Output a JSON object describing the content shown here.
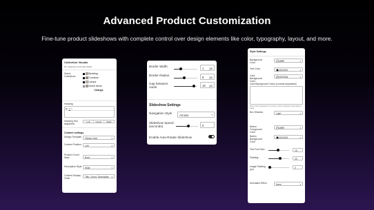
{
  "hero": {
    "title": "Advanced Product Customization",
    "subtitle": "Fine-tune product slideshows with complete control over design elements like color, typography, layout, and more."
  },
  "panel1": {
    "title": "Collection Visuals",
    "subtitle": "ID: Collection & Product Slider",
    "select_label": "Select Collections",
    "collections": [
      {
        "label": "Bedding",
        "checked": true
      },
      {
        "label": "Furniture",
        "checked": true
      },
      {
        "label": "Lamps",
        "checked": true
      },
      {
        "label": "Home items",
        "checked": false
      }
    ],
    "change_button": "Change",
    "heading_label": "Heading",
    "heading_align_label": "Heading Text Alignment",
    "align_options": [
      "Left",
      "Center",
      "Right"
    ],
    "content_settings": "Content settings",
    "fields": [
      {
        "label": "Design Template",
        "value": "Glossy Card"
      },
      {
        "label": "Content Position",
        "value": "Left"
      },
      {
        "label": "Product Count Style",
        "value": "Bold"
      },
      {
        "label": "Description Style",
        "value": "Wide"
      },
      {
        "label": "Content Display Order",
        "value": "Title, Count, Description"
      }
    ]
  },
  "panel2": {
    "rows": [
      {
        "label": "Border Width",
        "value": "1",
        "unit": "px",
        "level": 0.3
      },
      {
        "label": "Border Radius",
        "value": "8",
        "unit": "px",
        "level": 0.45
      },
      {
        "label": "Gap between cards",
        "value": "16",
        "unit": "px",
        "level": 0.85
      }
    ],
    "section": "Slideshow Settings",
    "nav_label": "Navigation Style",
    "nav_value": "Arrows",
    "speed_label": "Slideshow Speed (seconds)",
    "speed_value": "5",
    "speed_level": 0.55,
    "autorotate_label": "Enable Auto-Rotate Slideshow",
    "autorotate_on": true
  },
  "panel3": {
    "title": "Style Settings",
    "background_label": "Background Color",
    "background_value": "#ffffff",
    "text_color_label": "Text Color",
    "text_color_value": "#000000",
    "card_bg_label": "Card Background Color",
    "card_bg_value": "#f2f2f2fa",
    "card_colors_label": "Card Background Colors (comma-separated)",
    "box_shadow_label": "Box Shadow",
    "box_shadow_value": "Light",
    "btn_fg_label": "Button Foreground Color",
    "btn_fg_value": "#ffffff",
    "btn_bg_label": "Button Background Color",
    "btn_bg_value": "#000000",
    "font_size_label": "Text Font Size",
    "font_size_value": "16",
    "font_size_level": 0.45,
    "padding_label": "Padding",
    "padding_value": "20",
    "padding_level": 0.55,
    "image_padding_label": "Image Padding (px)",
    "image_padding_value": "0",
    "image_padding_level": 0.05,
    "animation_label": "Animation Effect",
    "animation_value": "None"
  },
  "colors": {
    "accent": "#111111",
    "background_top": "#000000",
    "background_bottom": "#2c1550"
  }
}
